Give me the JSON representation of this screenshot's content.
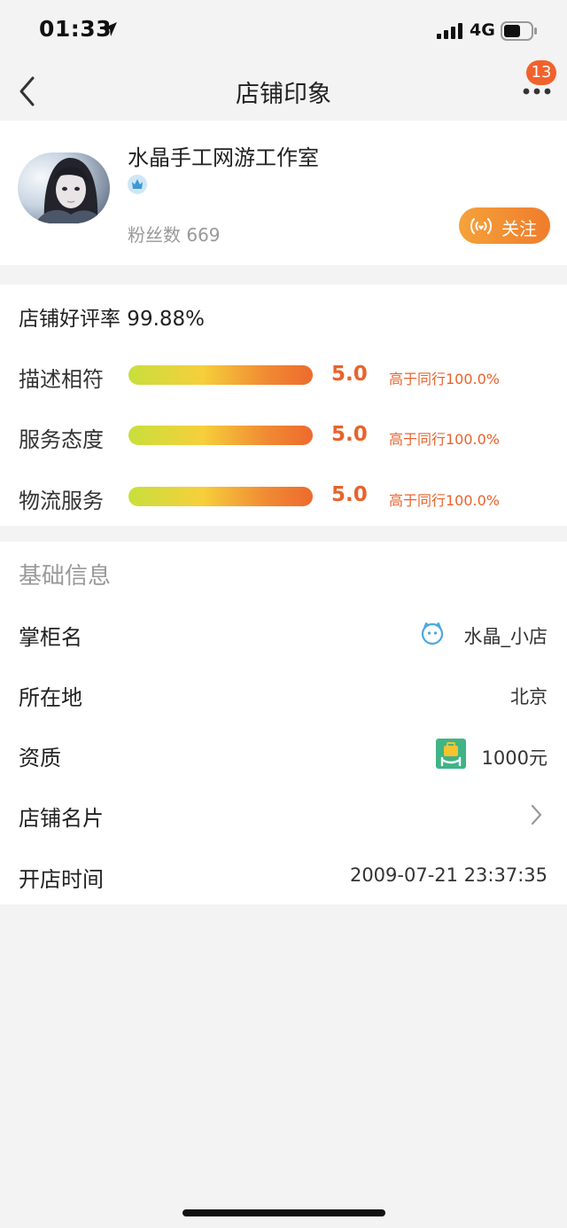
{
  "status_bar": {
    "time": "01:33",
    "network": "4G"
  },
  "nav": {
    "title": "店铺印象",
    "badge_count": "13"
  },
  "shop": {
    "name": "水晶手工网游工作室",
    "fans_label": "粉丝数",
    "fans_count": "669",
    "follow_label": "关注"
  },
  "rating": {
    "title": "店铺好评率 99.88%",
    "items": [
      {
        "label": "描述相符",
        "score": "5.0",
        "compare": "高于同行100.0%",
        "level": 1.0
      },
      {
        "label": "服务态度",
        "score": "5.0",
        "compare": "高于同行100.0%",
        "level": 1.0
      },
      {
        "label": "物流服务",
        "score": "5.0",
        "compare": "高于同行100.0%",
        "level": 1.0
      }
    ]
  },
  "info": {
    "title": "基础信息",
    "rows": [
      {
        "label": "掌柜名",
        "value": "水晶_小店"
      },
      {
        "label": "所在地",
        "value": "北京"
      },
      {
        "label": "资质",
        "value": "1000元"
      },
      {
        "label": "店铺名片",
        "value": ""
      },
      {
        "label": "开店时间",
        "value": "2009-07-21 23:37:35"
      }
    ]
  },
  "colors": {
    "accent": "#f0622c",
    "score": "#e8632c",
    "follow_gradient_start": "#f5a23a",
    "follow_gradient_end": "#f07c2c",
    "qualification_icon": "#3fb486"
  }
}
